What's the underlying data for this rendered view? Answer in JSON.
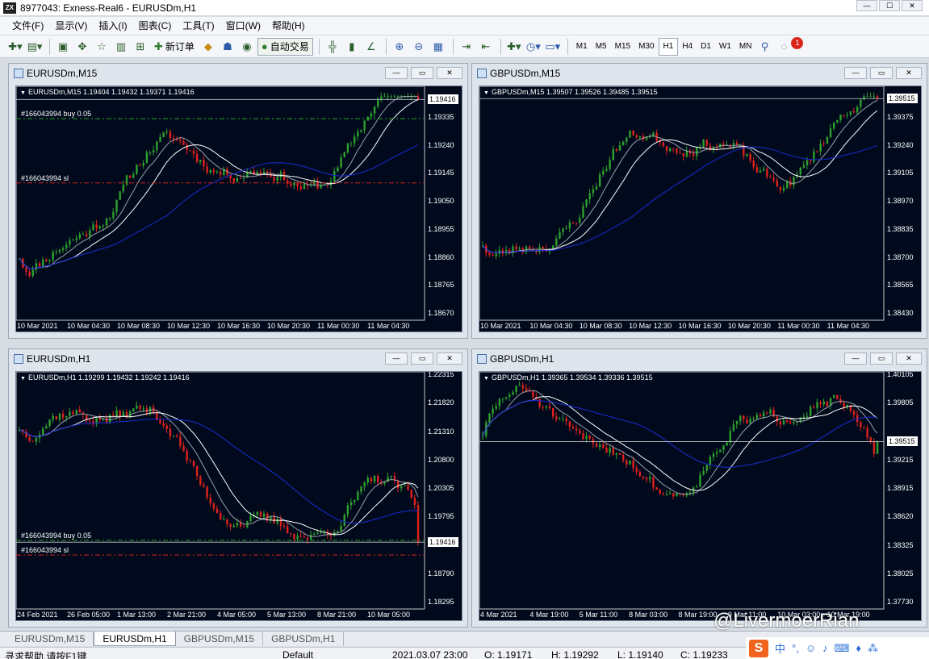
{
  "app": {
    "title": "8977043: Exness-Real6 - EURUSDm,H1",
    "icon": "exness-logo-icon"
  },
  "menu": [
    "文件(F)",
    "显示(V)",
    "插入(I)",
    "图表(C)",
    "工具(T)",
    "窗口(W)",
    "帮助(H)"
  ],
  "toolbar": {
    "new_order": "新订单",
    "auto_trade": "自动交易",
    "timeframes": [
      "M1",
      "M5",
      "M15",
      "M30",
      "H1",
      "H4",
      "D1",
      "W1",
      "MN"
    ],
    "active_timeframe": "H1",
    "notifications": "1"
  },
  "windows": [
    {
      "id": "w1",
      "title": "EURUSDm,M15",
      "info": "EURUSDm,M15  1.19404 1.19432 1.19371 1.19416",
      "price_levels": [
        "1.19416",
        "1.19335",
        "1.19240",
        "1.19145",
        "1.19050",
        "1.18955",
        "1.18860",
        "1.18765",
        "1.18670"
      ],
      "current_price": "1.19416",
      "time_labels": [
        "10 Mar 2021",
        "10 Mar 04:30",
        "10 Mar 08:30",
        "10 Mar 12:30",
        "10 Mar 16:30",
        "10 Mar 20:30",
        "11 Mar 00:30",
        "11 Mar 04:30"
      ],
      "orders": [
        {
          "label": "#166043994 buy 0.05",
          "price": 1.1935,
          "color": "#2ea02e"
        },
        {
          "label": "#166043994 sl",
          "price": 1.1913,
          "color": "#d92020"
        }
      ],
      "ymin": 1.1867,
      "ymax": 1.1945,
      "start": 1.1893,
      "end": 1.19416,
      "seed": 11
    },
    {
      "id": "w2",
      "title": "GBPUSDm,M15",
      "info": "GBPUSDm,M15  1.39507 1.39526 1.39485 1.39515",
      "price_levels": [
        "1.39515",
        "1.39375",
        "1.39240",
        "1.39105",
        "1.38970",
        "1.38835",
        "1.38700",
        "1.38565",
        "1.38430"
      ],
      "current_price": "1.39515",
      "time_labels": [
        "10 Mar 2021",
        "10 Mar 04:30",
        "10 Mar 08:30",
        "10 Mar 12:30",
        "10 Mar 16:30",
        "10 Mar 20:30",
        "11 Mar 00:30",
        "11 Mar 04:30"
      ],
      "orders": [],
      "ymin": 1.3843,
      "ymax": 1.3956,
      "start": 1.3886,
      "end": 1.39515,
      "seed": 23
    },
    {
      "id": "w3",
      "title": "EURUSDm,H1",
      "info": "EURUSDm,H1  1.19299 1.19432 1.19242 1.19416",
      "price_levels": [
        "1.22315",
        "1.21820",
        "1.21310",
        "1.20800",
        "1.20305",
        "1.19795",
        "1.19416",
        "1.18790",
        "1.18295"
      ],
      "current_price": "1.19416",
      "time_labels": [
        "24 Feb 2021",
        "26 Feb 05:00",
        "1 Mar 13:00",
        "2 Mar 21:00",
        "4 Mar 05:00",
        "5 Mar 13:00",
        "8 Mar 21:00",
        "10 Mar 05:00"
      ],
      "orders": [
        {
          "label": "#166043994 buy 0.05",
          "price": 1.1945,
          "color": "#2ea02e"
        },
        {
          "label": "#166043994 sl",
          "price": 1.1918,
          "color": "#d92020"
        }
      ],
      "ymin": 1.1825,
      "ymax": 1.2248,
      "start": 1.217,
      "end": 1.19416,
      "seed": 37
    },
    {
      "id": "w4",
      "title": "GBPUSDm,H1",
      "info": "GBPUSDm,H1  1.39365 1.39534 1.39336 1.39515",
      "price_levels": [
        "1.40105",
        "1.39805",
        "1.39515",
        "1.39215",
        "1.38915",
        "1.38620",
        "1.38325",
        "1.38025",
        "1.37730"
      ],
      "current_price": "1.39515",
      "time_labels": [
        "4 Mar 2021",
        "4 Mar 19:00",
        "5 Mar 11:00",
        "8 Mar 03:00",
        "8 Mar 19:00",
        "9 Mar 11:00",
        "10 Mar 03:00",
        "10 Mar 19:00"
      ],
      "orders": [],
      "ymin": 1.377,
      "ymax": 1.4025,
      "start": 1.395,
      "end": 1.39515,
      "seed": 51
    }
  ],
  "tabs": [
    "EURUSDm,M15",
    "EURUSDm,H1",
    "GBPUSDm,M15",
    "GBPUSDm,H1"
  ],
  "active_tab": "EURUSDm,H1",
  "status": {
    "help": "寻求帮助,请按F1键",
    "profile": "Default",
    "datetime": "2021.03.07 23:00",
    "open": "O: 1.19171",
    "high": "H: 1.19292",
    "low": "L: 1.19140",
    "close": "C: 1.19233"
  },
  "watermark": "@LivermoerRian",
  "ime": {
    "logo": "S",
    "mode": "中"
  },
  "colors": {
    "chart_bg": "#000a1c",
    "bull": "#2ea02e",
    "bear": "#e0211c",
    "ma_fast": "#ffffff",
    "ma_mid": "#9aa0a8",
    "ma_slow": "#1a2bd6"
  }
}
